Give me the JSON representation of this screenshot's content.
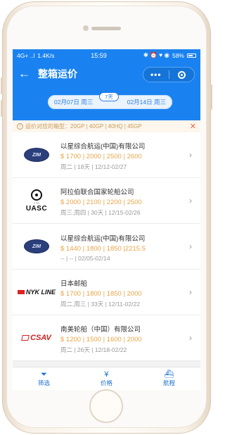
{
  "status": {
    "signal": "4G+ ..l",
    "speed": "1.4K/s",
    "time": "15:59",
    "right_icons": "✱ ⏰ ♥ ◉",
    "battery": "58%"
  },
  "nav": {
    "back": "←",
    "title": "整箱运价",
    "capsule_dots": "•••"
  },
  "dates": {
    "start": "02月07日 周三",
    "days": "7天",
    "end": "02月14日 周三"
  },
  "notice": {
    "text": "运价对应的箱型：20GP | 40GP | 40HQ | 45GP",
    "close": "✕"
  },
  "items": [
    {
      "name": "以星综合航运(中国)有限公司",
      "prices": "$ 1700 | 2000 | 2500 | 2600",
      "meta": "周二 | 18天 | 12/12-02/27",
      "logo_text": "ZIM"
    },
    {
      "name": "阿拉伯联合国家轮船公司",
      "prices": "$ 2000 | 2100 | 2200 | 2500",
      "meta": "周三,周四 | 30天 | 12/15-02/26",
      "logo_text": "UASC"
    },
    {
      "name": "以星综合航运(中国)有限公司",
      "prices": "$ 1440 | 1800 | 1850 |2215.5",
      "meta": "-- | -- | 02/05-02/14",
      "logo_text": "ZIM"
    },
    {
      "name": "日本邮船",
      "prices": "$ 1700 | 1800 | 1850 | 2000",
      "meta": "周二,周三 | 33天 | 12/11-02/22",
      "logo_text": "NYK LINE"
    },
    {
      "name": "南美轮船（中国）有限公司",
      "prices": "$ 1200 | 1500 | 1600 | 2000",
      "meta": "周二 | 26天 | 12/18-02/22",
      "logo_text": "CSAV"
    }
  ],
  "tabs": [
    {
      "label": "筛选",
      "icon": "filter-icon"
    },
    {
      "label": "价格",
      "icon": "yen-icon"
    },
    {
      "label": "航程",
      "icon": "ship-icon"
    }
  ]
}
